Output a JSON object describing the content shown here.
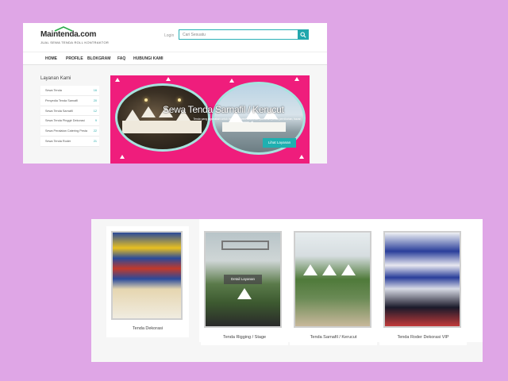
{
  "colors": {
    "background": "#dfa6e6",
    "accent": "#22a7ad",
    "banner": "#ef1d7c",
    "oval_border": "#a7e3df"
  },
  "site": {
    "logo_text": "Maintenda.com",
    "logo_tagline": "JUAL SEWA TENDA ROLL KONTRAKTOR",
    "login": "Login",
    "search_placeholder": "Cari Sesuatu",
    "search_icon": "search-icon"
  },
  "nav": [
    "HOME",
    "PROFILE",
    "BLOKGRAM",
    "FAQ",
    "HUBUNGI KAMI"
  ],
  "sidebar": {
    "title": "Layanan Kami",
    "items": [
      {
        "label": "Sewa Tenda",
        "count": "16"
      },
      {
        "label": "Penyedia Tenda Sarnafil",
        "count": "20"
      },
      {
        "label": "Sewa Tenda Sarnafil",
        "count": "12"
      },
      {
        "label": "Sewa Tenda Pinggir Dekorasi",
        "count": "9"
      },
      {
        "label": "Sewa Peralatan Catering Pesta",
        "count": "22"
      },
      {
        "label": "Sewa Tenda Roder",
        "count": "21"
      }
    ]
  },
  "banner": {
    "title": "Sewa Tenda Sarnafil / Kerucut",
    "subtitle": "Tenda yang digunakan untuk berbagai event acara dan pameran, pesta pernikahan, bazar, konser, dll",
    "button": "Lihat Layanan"
  },
  "products": [
    {
      "caption": "Tenda Dekorasi"
    },
    {
      "caption": "Tenda Rigging / Stage",
      "overlay_button": "Detail Layanan"
    },
    {
      "caption": "Tenda Sarnafil / Kerucut"
    },
    {
      "caption": "Tenda Roder Dekorasi VIP"
    }
  ]
}
